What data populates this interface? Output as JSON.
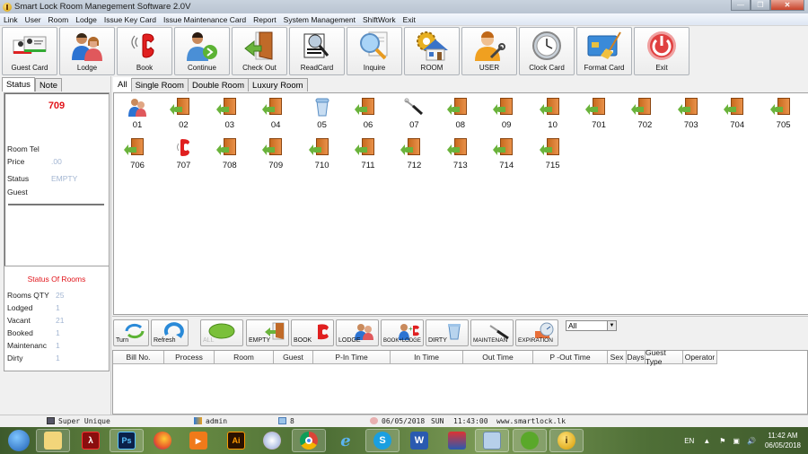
{
  "window": {
    "title": "Smart Lock Room Manegement Software 2.0V",
    "controls": [
      "minimize",
      "restore",
      "close"
    ]
  },
  "menu": [
    "Link",
    "User",
    "Room",
    "Lodge",
    "Issue Key Card",
    "Issue Maintenance Card",
    "Report",
    "System Management",
    "ShiftWork",
    "Exit"
  ],
  "toolbar": [
    {
      "label": "Guest Card",
      "icon": "guest-card-icon"
    },
    {
      "label": "Lodge",
      "icon": "lodge-icon"
    },
    {
      "label": "Book",
      "icon": "phone-icon"
    },
    {
      "label": "Continue",
      "icon": "continue-icon"
    },
    {
      "label": "Check Out",
      "icon": "door-exit-icon"
    },
    {
      "label": "ReadCard",
      "icon": "read-card-icon"
    },
    {
      "label": "Inquire",
      "icon": "magnifier-icon"
    },
    {
      "label": "ROOM",
      "icon": "room-gear-icon"
    },
    {
      "label": "USER",
      "icon": "user-wrench-icon"
    },
    {
      "label": "Clock Card",
      "icon": "clock-icon"
    },
    {
      "label": "Format Card",
      "icon": "format-card-icon"
    },
    {
      "label": "Exit",
      "icon": "power-icon"
    }
  ],
  "left": {
    "tabs": [
      "Status",
      "Note"
    ],
    "active_tab": "Status",
    "room_number": "709",
    "fields": [
      {
        "label": "Room Tel",
        "value": ""
      },
      {
        "label": "Price",
        "value": ".00"
      },
      {
        "label": "Status",
        "value": "EMPTY"
      },
      {
        "label": "Guest",
        "value": ""
      }
    ],
    "room_status": {
      "title": "Status Of Rooms",
      "rows": [
        {
          "label": "Rooms QTY",
          "value": "25"
        },
        {
          "label": "Lodged",
          "value": "1"
        },
        {
          "label": "Vacant",
          "value": "21"
        },
        {
          "label": "Booked",
          "value": "1"
        },
        {
          "label": "Maintenanc",
          "value": "1"
        },
        {
          "label": "Dirty",
          "value": "1"
        }
      ]
    }
  },
  "room_tabs": [
    "All",
    "Single Room",
    "Double Room",
    "Luxury Room"
  ],
  "active_room_tab": "All",
  "rooms": [
    {
      "no": "01",
      "state": "lodged"
    },
    {
      "no": "02",
      "state": "empty"
    },
    {
      "no": "03",
      "state": "empty"
    },
    {
      "no": "04",
      "state": "empty"
    },
    {
      "no": "05",
      "state": "dirty"
    },
    {
      "no": "06",
      "state": "empty"
    },
    {
      "no": "07",
      "state": "maintenance"
    },
    {
      "no": "08",
      "state": "empty"
    },
    {
      "no": "09",
      "state": "empty"
    },
    {
      "no": "10",
      "state": "empty"
    },
    {
      "no": "701",
      "state": "empty"
    },
    {
      "no": "702",
      "state": "empty"
    },
    {
      "no": "703",
      "state": "empty"
    },
    {
      "no": "704",
      "state": "empty"
    },
    {
      "no": "705",
      "state": "empty"
    },
    {
      "no": "706",
      "state": "empty"
    },
    {
      "no": "707",
      "state": "booked"
    },
    {
      "no": "708",
      "state": "empty"
    },
    {
      "no": "709",
      "state": "empty"
    },
    {
      "no": "710",
      "state": "empty"
    },
    {
      "no": "711",
      "state": "empty"
    },
    {
      "no": "712",
      "state": "empty"
    },
    {
      "no": "713",
      "state": "empty"
    },
    {
      "no": "714",
      "state": "empty"
    },
    {
      "no": "715",
      "state": "empty"
    }
  ],
  "filters": [
    {
      "label": "Turn",
      "icon": "turn-arrows-icon"
    },
    {
      "label": "Refresh",
      "icon": "refresh-icon"
    },
    {
      "label": "ALL",
      "icon": "all-ellipse-icon"
    },
    {
      "label": "EMPTY",
      "icon": "door-exit-icon"
    },
    {
      "label": "BOOK",
      "icon": "phone-icon"
    },
    {
      "label": "LODGE",
      "icon": "lodge-icon"
    },
    {
      "label": "BOOK+LODGE",
      "icon": "book-lodge-icon"
    },
    {
      "label": "DIRTY",
      "icon": "trash-icon"
    },
    {
      "label": "MAINTENAN",
      "icon": "tools-icon"
    },
    {
      "label": "EXPIRATION",
      "icon": "expiration-icon"
    }
  ],
  "filter_select": {
    "value": "All"
  },
  "bill_table": {
    "columns": [
      "Bill No.",
      "Process",
      "Room",
      "Guest",
      "P-In Time",
      "In Time",
      "Out Time",
      "P -Out Time",
      "Sex",
      "Days",
      "Guest Type",
      "Operator"
    ],
    "rows": []
  },
  "status_strip": {
    "company": "Super Unique",
    "user": "admin",
    "count": "8",
    "date": "06/05/2018",
    "day": "SUN",
    "time": "11:43:00",
    "website": "www.smartlock.lk"
  },
  "taskbar": {
    "apps": [
      "start",
      "file-explorer",
      "acrobat",
      "photoshop",
      "firefox",
      "media-player",
      "illustrator",
      "paint",
      "chrome",
      "internet-explorer",
      "skype",
      "word",
      "app-3d",
      "calculator",
      "corel",
      "smart-lock"
    ],
    "tray": {
      "language": "EN",
      "time": "11:42 AM",
      "date": "06/05/2018"
    }
  }
}
